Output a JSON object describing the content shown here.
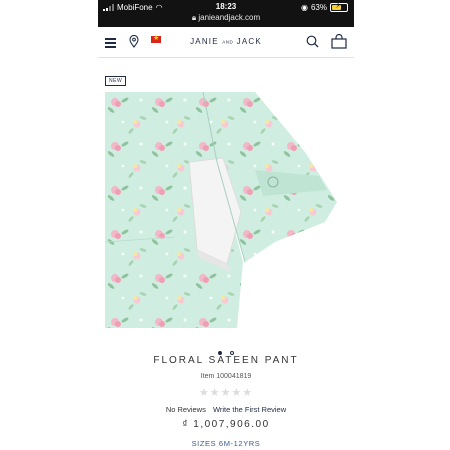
{
  "status_bar": {
    "carrier": "MobiFone",
    "time": "18:23",
    "url": "janieandjack.com",
    "battery": "63%"
  },
  "header": {
    "brand_left": "JANIE",
    "brand_mid": "AND",
    "brand_right": "JACK"
  },
  "product": {
    "badge": "NEW",
    "title": "FLORAL SATEEN PANT",
    "item_number": "Item 100041819",
    "rating_stars": "★★★★★",
    "no_reviews": "No Reviews",
    "write_review": "Write the First Review",
    "price": "₫ 1,007,906.00",
    "sizes": "SIZES 6M-12YRS",
    "carousel_active_index": 1,
    "carousel_count": 2
  },
  "colors": {
    "brand_navy": "#1f2a44",
    "fabric_mint": "#cfeee1",
    "link_blue": "#3b5b8f"
  }
}
